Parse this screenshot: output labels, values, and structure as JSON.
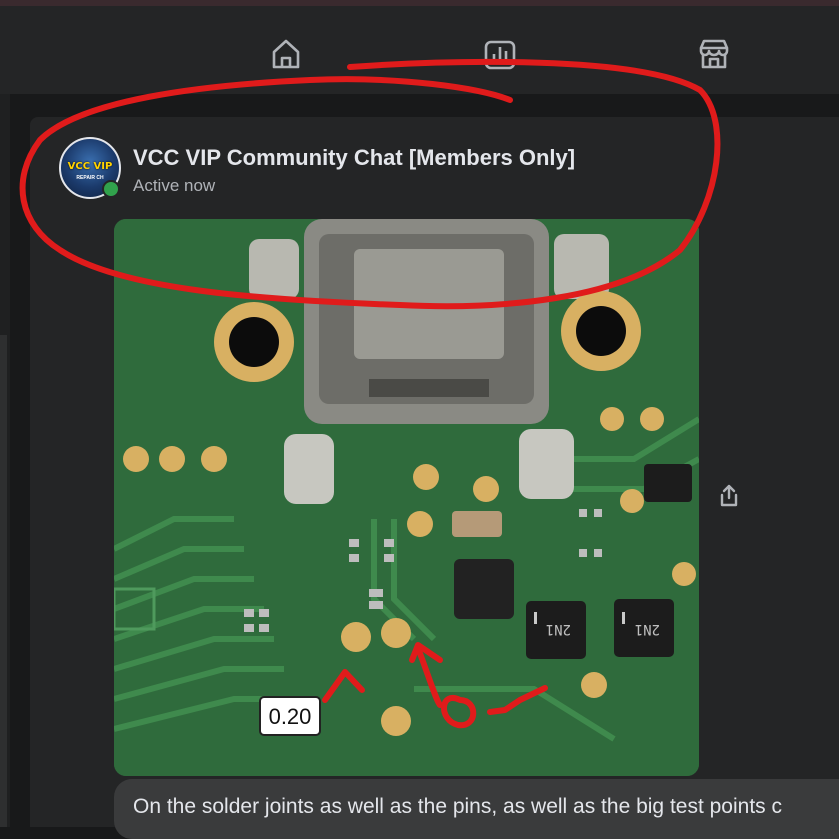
{
  "nav": {
    "items": [
      {
        "icon": "home-icon"
      },
      {
        "icon": "chart-icon"
      },
      {
        "icon": "store-icon"
      }
    ]
  },
  "post": {
    "group_name": "VCC VIP Community Chat [Members Only]",
    "status": "Active now",
    "avatar_text": "VCC VIP",
    "avatar_sub": "REPAIR CH",
    "photo_label": "0.20",
    "caption": "On the solder joints as well as the pins, as well as the big test points c"
  },
  "colors": {
    "annotation_red": "#e01b1b",
    "pcb_green": "#2f6b3c",
    "active_green": "#31a24c"
  }
}
